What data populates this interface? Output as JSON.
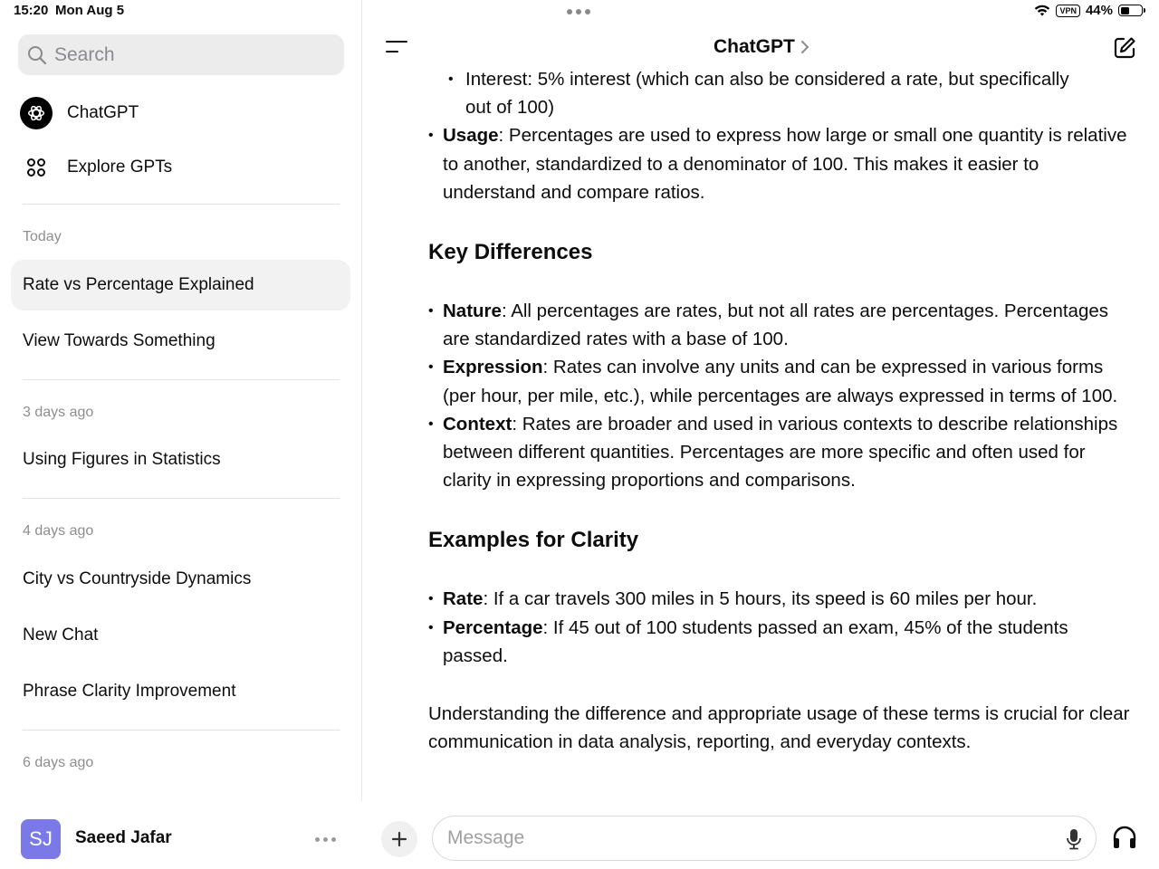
{
  "status_bar": {
    "time": "15:20",
    "date": "Mon Aug 5",
    "vpn": "VPN",
    "battery_percent": "44%",
    "battery_level": 0.44
  },
  "sidebar": {
    "search_placeholder": "Search",
    "nav": [
      {
        "label": "ChatGPT",
        "icon": "openai-logo-icon"
      },
      {
        "label": "Explore GPTs",
        "icon": "grid-icon"
      }
    ],
    "sections": [
      {
        "label": "Today",
        "items": [
          "Rate vs Percentage Explained",
          "View Towards Something"
        ]
      },
      {
        "label": "3 days ago",
        "items": [
          "Using Figures in Statistics"
        ]
      },
      {
        "label": "4 days ago",
        "items": [
          "City vs Countryside Dynamics",
          "New Chat",
          "Phrase Clarity Improvement"
        ]
      },
      {
        "label": "6 days ago",
        "items": []
      }
    ],
    "active_item": "Rate vs Percentage Explained",
    "user": {
      "initials": "SJ",
      "name": "Saeed Jafar",
      "avatar_color": "#7b78e8"
    }
  },
  "header": {
    "title": "ChatGPT",
    "title_chevron": "›"
  },
  "message": {
    "sub_bullet_line1": "Interest: 5% interest (which can also be considered a rate, but specifically",
    "sub_bullet_line2": "out of 100)",
    "usage_term": "Usage",
    "usage_text": ": Percentages are used to express how large or small one quantity is relative to another, standardized to a denominator of 100. This makes it easier to understand and compare ratios.",
    "heading_differences": "Key Differences",
    "differences": [
      {
        "term": "Nature",
        "text": ": All percentages are rates, but not all rates are percentages. Percentages are standardized rates with a base of 100."
      },
      {
        "term": "Expression",
        "text": ": Rates can involve any units and can be expressed in various forms (per hour, per mile, etc.), while percentages are always expressed in terms of 100."
      },
      {
        "term": "Context",
        "text": ": Rates are broader and used in various contexts to describe relationships between different quantities. Percentages are more specific and often used for clarity in expressing proportions and comparisons."
      }
    ],
    "heading_examples": "Examples for Clarity",
    "examples": [
      {
        "term": "Rate",
        "text": ": If a car travels 300 miles in 5 hours, its speed is 60 miles per hour."
      },
      {
        "term": "Percentage",
        "text": ": If 45 out of 100 students passed an exam, 45% of the students passed."
      }
    ],
    "conclusion": "Understanding the difference and appropriate usage of these terms is crucial for clear communication in data analysis, reporting, and everyday contexts."
  },
  "composer": {
    "placeholder": "Message"
  },
  "colors": {
    "accent_avatar": "#7b78e8",
    "active_item_bg": "#f2f2f2",
    "muted_text": "#8e8e8e"
  }
}
